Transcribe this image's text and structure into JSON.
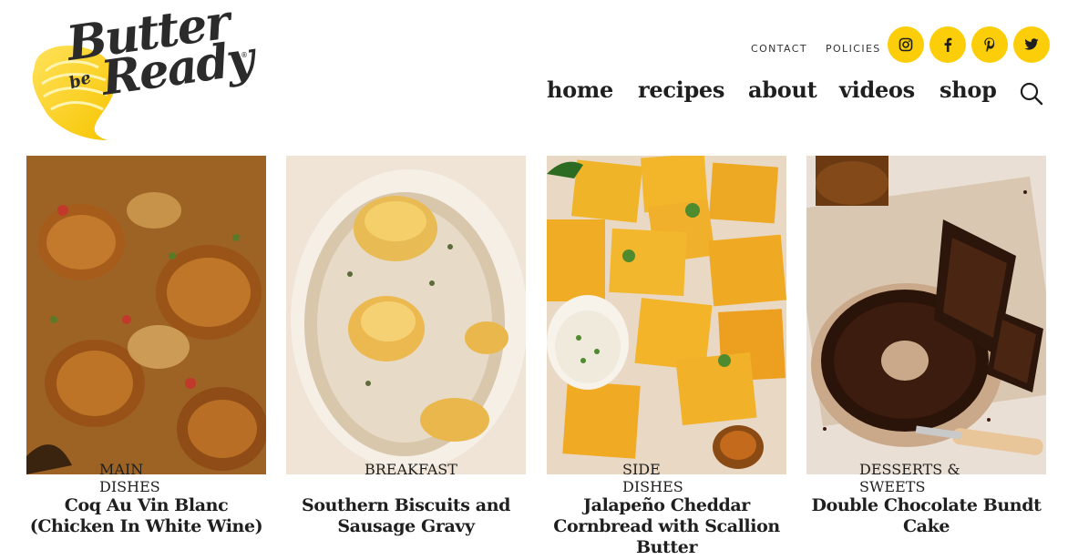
{
  "logo": {
    "line1": "Butter",
    "line2": "be",
    "line3": "Ready",
    "registered": "®"
  },
  "utility_nav": [
    {
      "label": "CONTACT"
    },
    {
      "label": "POLICIES"
    }
  ],
  "social": [
    {
      "icon": "instagram-icon"
    },
    {
      "icon": "facebook-icon"
    },
    {
      "icon": "pinterest-icon"
    },
    {
      "icon": "twitter-icon"
    }
  ],
  "main_nav": {
    "home": "home",
    "recipes": "recipes",
    "about": "about",
    "videos": "videos",
    "shop": "shop"
  },
  "colors": {
    "accent_yellow": "#fcce0a",
    "text_dark": "#1f1f1f"
  },
  "cards": [
    {
      "category": "MAIN DISHES",
      "title": "Coq Au Vin Blanc (Chicken In White Wine)"
    },
    {
      "category": "BREAKFAST",
      "title": "Southern Biscuits and Sausage Gravy"
    },
    {
      "category": "SIDE DISHES",
      "title": "Jalapeño Cheddar Cornbread with Scallion Butter"
    },
    {
      "category": "DESSERTS & SWEETS",
      "title": "Double Chocolate Bundt Cake"
    }
  ]
}
